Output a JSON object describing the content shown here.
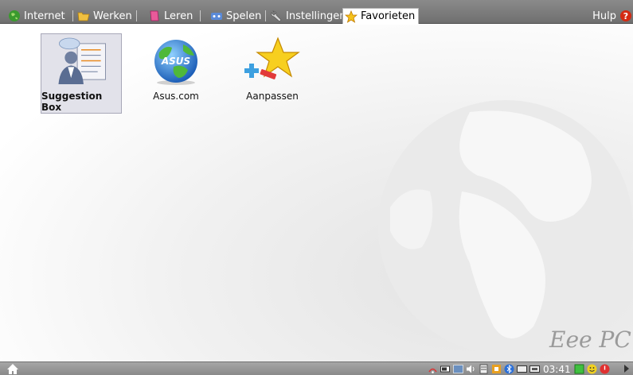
{
  "tabs": [
    {
      "label": "Internet",
      "icon": "globe-icon"
    },
    {
      "label": "Werken",
      "icon": "folder-icon"
    },
    {
      "label": "Leren",
      "icon": "book-icon"
    },
    {
      "label": "Spelen",
      "icon": "game-icon"
    },
    {
      "label": "Instellingen",
      "icon": "wrench-icon"
    },
    {
      "label": "Favorieten",
      "icon": "star-icon",
      "active": true
    }
  ],
  "help": {
    "label": "Hulp",
    "glyph": "?"
  },
  "apps": [
    {
      "label": "Suggestion Box",
      "icon": "suggestion-box-icon",
      "selected": true
    },
    {
      "label": "Asus.com",
      "icon": "asus-globe-icon"
    },
    {
      "label": "Aanpassen",
      "icon": "customize-star-icon"
    }
  ],
  "watermark": {
    "logo": "Eee PC"
  },
  "taskbar": {
    "clock": "03:41",
    "home_icon": "home-icon"
  },
  "colors": {
    "topbar": "#7d7d7d",
    "taskbar": "#989898",
    "selected_bg": "#e2e2ea"
  }
}
